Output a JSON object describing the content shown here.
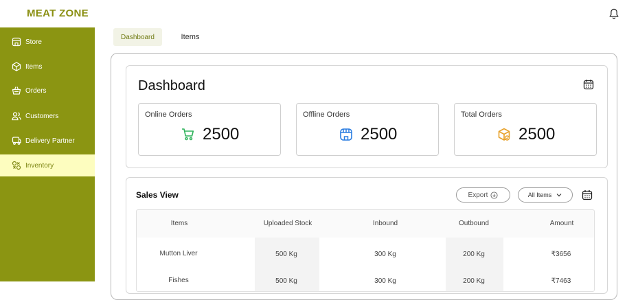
{
  "app": {
    "brand": "MEAT ZONE"
  },
  "colors": {
    "sidebar": "#8b9512",
    "active_nav_bg": "#fdfdbf",
    "brand": "#8a8f12"
  },
  "sidebar": {
    "items": [
      {
        "label": "Store",
        "icon": "store-icon"
      },
      {
        "label": "Items",
        "icon": "box-icon"
      },
      {
        "label": "Orders",
        "icon": "basket-icon"
      },
      {
        "label": "Customers",
        "icon": "users-icon"
      },
      {
        "label": "Delivery Partner",
        "icon": "truck-icon"
      },
      {
        "label": "Inventory",
        "icon": "inventory-icon",
        "active": true
      }
    ]
  },
  "tabs": [
    {
      "label": "Dashboard",
      "active": true
    },
    {
      "label": "Items",
      "active": false
    }
  ],
  "dashboard": {
    "title": "Dashboard",
    "stats": [
      {
        "label": "Online Orders",
        "value": "2500",
        "icon": "cart-icon"
      },
      {
        "label": "Offline Orders",
        "value": "2500",
        "icon": "shop-icon"
      },
      {
        "label": "Total Orders",
        "value": "2500",
        "icon": "package-icon"
      }
    ]
  },
  "sales": {
    "title": "Sales View",
    "export_label": "Export",
    "filter_label": "All Items",
    "columns": [
      "Items",
      "Uploaded Stock",
      "Inbound",
      "Outbound",
      "Amount"
    ],
    "rows": [
      [
        "Mutton Liver",
        "500 Kg",
        "300 Kg",
        "200 Kg",
        "₹3656"
      ],
      [
        "Fishes",
        "500 Kg",
        "300 Kg",
        "200 Kg",
        "₹7463"
      ]
    ]
  }
}
